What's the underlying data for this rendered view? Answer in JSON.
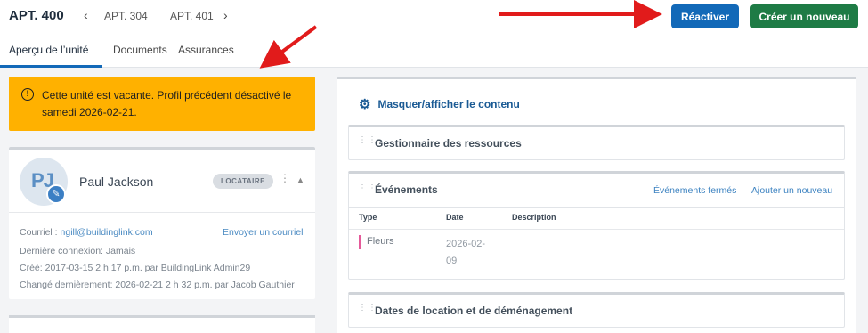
{
  "header": {
    "title": "APT. 400",
    "prev_apt": "APT. 304",
    "next_apt": "APT. 401",
    "reactivate_label": "Réactiver",
    "create_label": "Créer un nouveau"
  },
  "tabs": [
    {
      "label": "Aperçu de l’unité",
      "active": true
    },
    {
      "label": "Documents"
    },
    {
      "label": "Assurances"
    }
  ],
  "alert": {
    "icon": "exclamation-icon",
    "text": "Cette unité est vacante. Profil précédent désactivé le samedi 2026-02-21."
  },
  "person": {
    "initials": "PJ",
    "name": "Paul Jackson",
    "badge": "LOCATAIRE",
    "email_label": "Courriel :",
    "email": "ngill@buildinglink.com",
    "send_email": "Envoyer un courriel",
    "last_login_label": "Dernière connexion:",
    "last_login": "Jamais",
    "created_label": "Créé:",
    "created": "2017-03-15 2 h 17 p.m. par BuildingLink Admin29",
    "modified_label": "Changé dernièrement:",
    "modified": "2026-02-21 2 h 32 p.m. par Jacob Gauthier"
  },
  "right_panel": {
    "toggle_label": "Masquer/afficher le contenu",
    "sections": {
      "resources": {
        "title": "Gestionnaire des ressources"
      },
      "events": {
        "title": "Événements",
        "closed_link": "Événements fermés",
        "add_link": "Ajouter un nouveau",
        "columns": [
          "Type",
          "Date",
          "Description"
        ],
        "rows": [
          {
            "type": "Fleurs",
            "date": "2026-02-09",
            "description": "",
            "color": "#e55a9a"
          }
        ]
      },
      "dates": {
        "title": "Dates de location et de déménagement"
      }
    }
  },
  "colors": {
    "primary": "#1269b8",
    "success": "#1e7b45",
    "warning": "#ffb100",
    "annotation_arrow": "#e11b1b"
  }
}
